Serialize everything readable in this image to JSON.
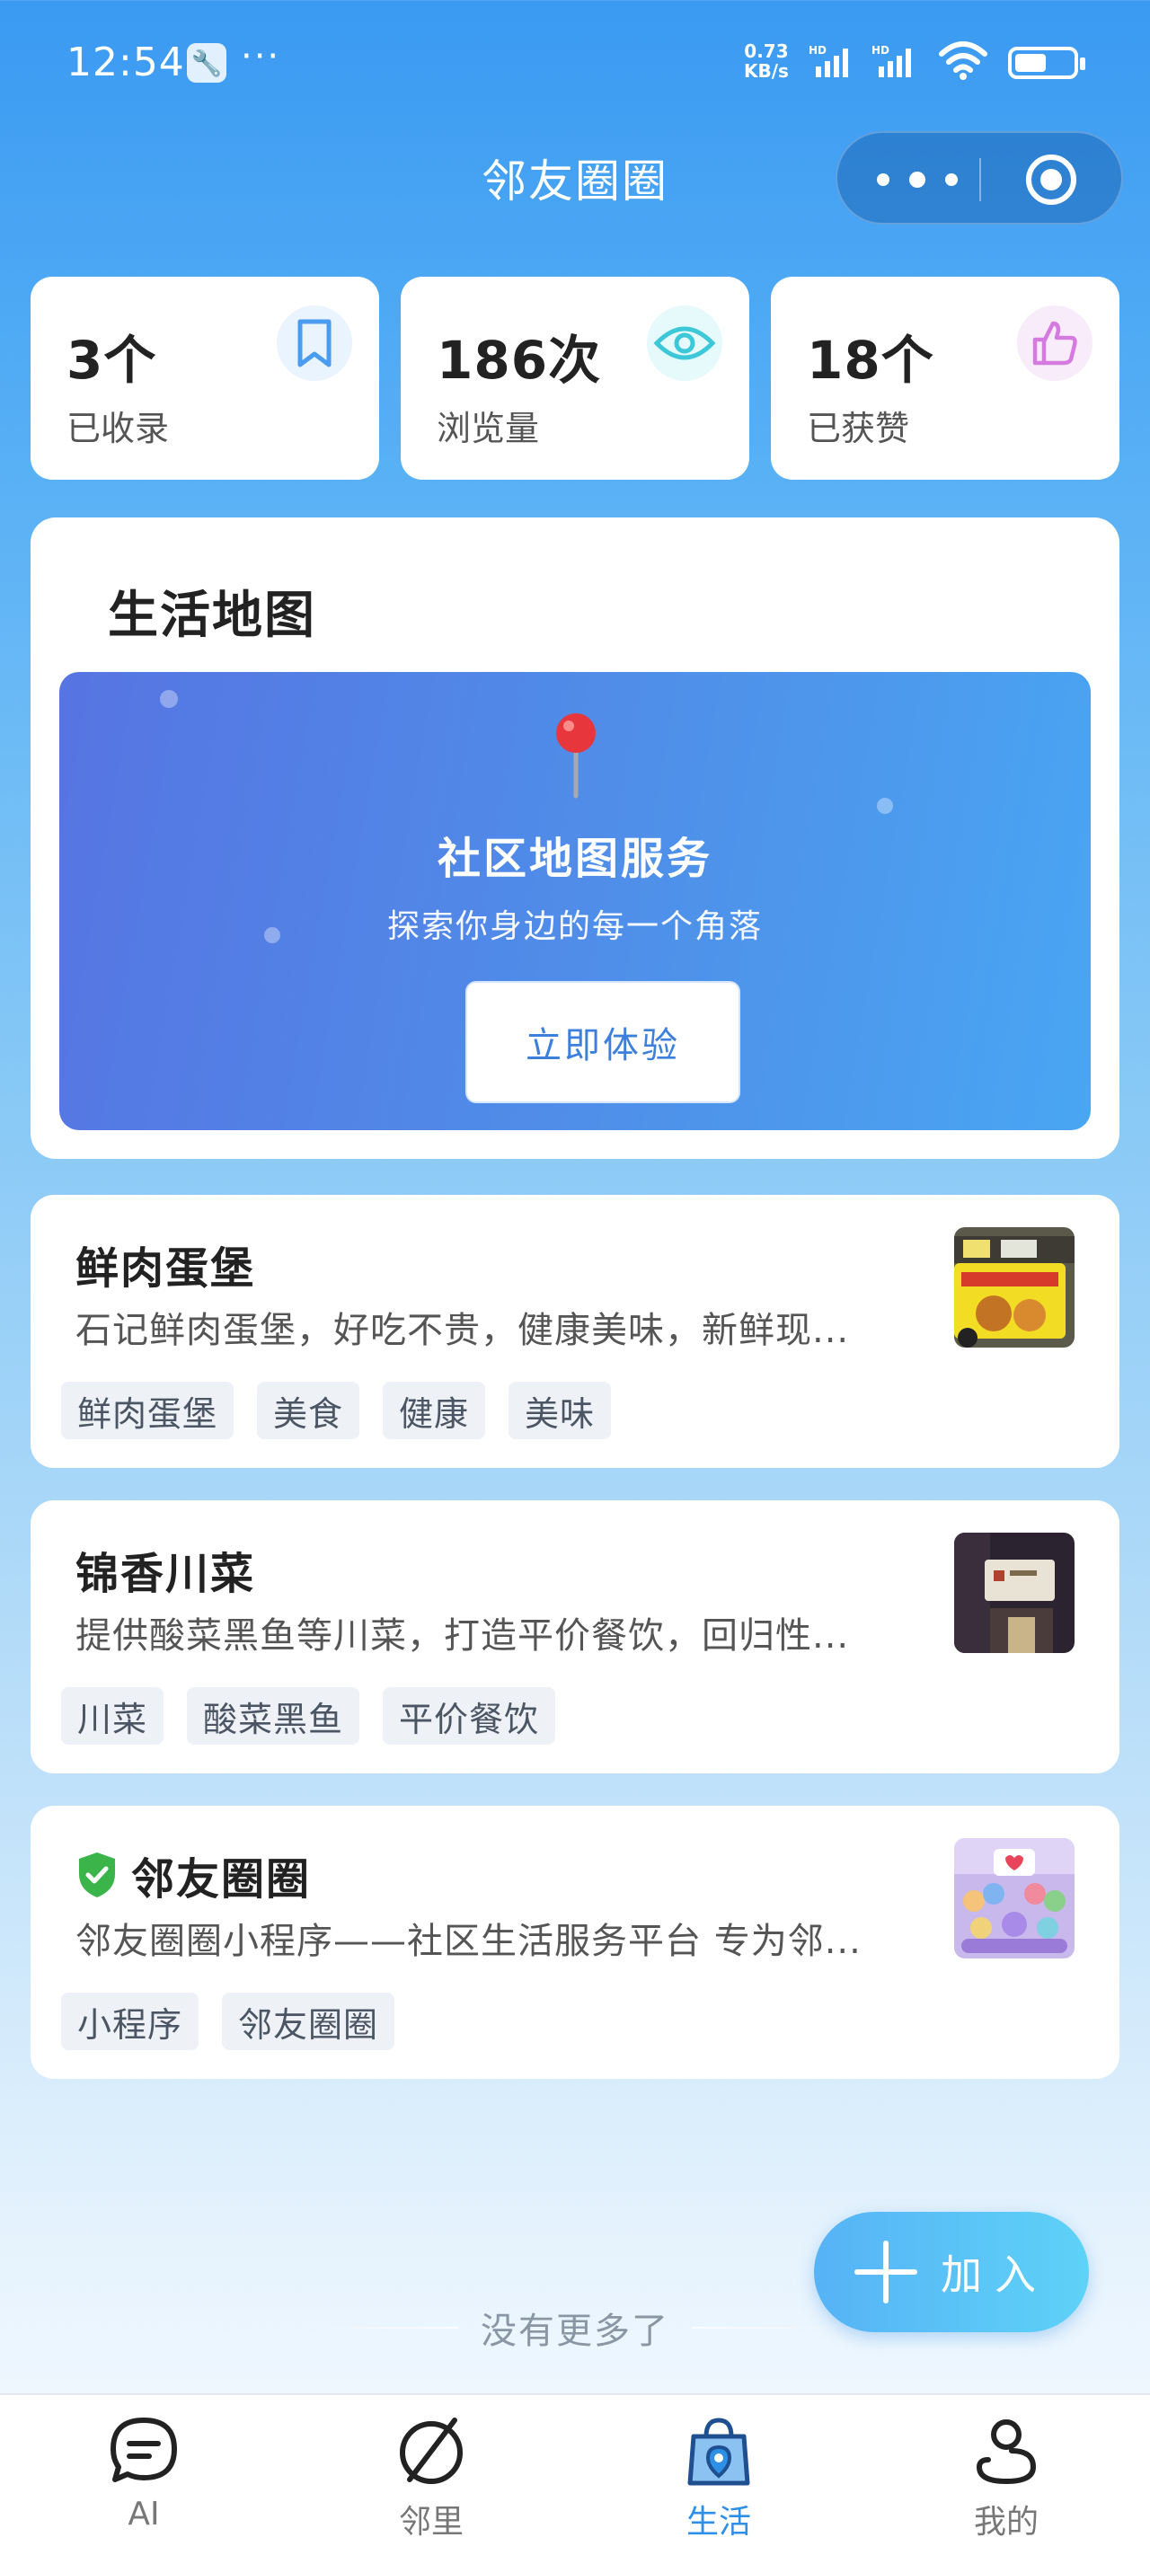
{
  "status_bar": {
    "time": "12:54",
    "dots": "···",
    "speed_value": "0.73",
    "speed_unit": "KB/s",
    "hd_label": "HD",
    "battery_level": 0.55
  },
  "header": {
    "title": "邻友圈圈"
  },
  "stats": [
    {
      "value": "3个",
      "label": "已收录",
      "icon": "bookmark-icon",
      "color": "#4a9cf0",
      "bg": "#eaf4fe"
    },
    {
      "value": "186次",
      "label": "浏览量",
      "icon": "eye-icon",
      "color": "#3cc8d8",
      "bg": "#e6f9fb"
    },
    {
      "value": "18个",
      "label": "已获赞",
      "icon": "thumbs-up-icon",
      "color": "#d57be0",
      "bg": "#f8ecfa"
    }
  ],
  "life_map": {
    "section_title": "生活地图",
    "banner_title": "社区地图服务",
    "banner_subtitle": "探索你身边的每一个角落",
    "cta_label": "立即体验"
  },
  "listings": [
    {
      "title": "鲜肉蛋堡",
      "description": "石记鲜肉蛋堡，好吃不贵，健康美味，新鲜现...",
      "tags": [
        "鲜肉蛋堡",
        "美食",
        "健康",
        "美味"
      ],
      "verified": false
    },
    {
      "title": "锦香川菜",
      "description": "提供酸菜黑鱼等川菜，打造平价餐饮，回归性...",
      "tags": [
        "川菜",
        "酸菜黑鱼",
        "平价餐饮"
      ],
      "verified": false
    },
    {
      "title": "邻友圈圈",
      "description": "邻友圈圈小程序——社区生活服务平台 专为邻...",
      "tags": [
        "小程序",
        "邻友圈圈"
      ],
      "verified": true
    }
  ],
  "end_of_list": "没有更多了",
  "fab": {
    "label": "加入"
  },
  "tab_bar": {
    "items": [
      {
        "label": "AI",
        "icon": "chat-icon",
        "active": false
      },
      {
        "label": "邻里",
        "icon": "compass-icon",
        "active": false
      },
      {
        "label": "生活",
        "icon": "shopping-bag-location-icon",
        "active": true
      },
      {
        "label": "我的",
        "icon": "user-icon",
        "active": false
      }
    ]
  },
  "colors": {
    "brand": "#3a9af2",
    "active_tab": "#2e8fe6",
    "verified": "#3bb54a"
  }
}
